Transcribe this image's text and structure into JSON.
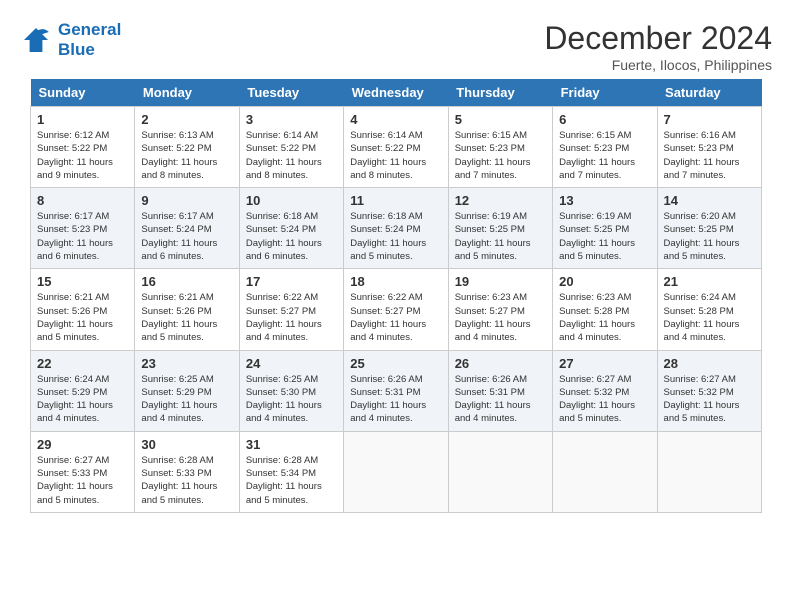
{
  "header": {
    "logo_line1": "General",
    "logo_line2": "Blue",
    "month": "December 2024",
    "location": "Fuerte, Ilocos, Philippines"
  },
  "days_of_week": [
    "Sunday",
    "Monday",
    "Tuesday",
    "Wednesday",
    "Thursday",
    "Friday",
    "Saturday"
  ],
  "weeks": [
    [
      {
        "day": 1,
        "sunrise": "6:12 AM",
        "sunset": "5:22 PM",
        "daylight": "11 hours and 9 minutes."
      },
      {
        "day": 2,
        "sunrise": "6:13 AM",
        "sunset": "5:22 PM",
        "daylight": "11 hours and 8 minutes."
      },
      {
        "day": 3,
        "sunrise": "6:14 AM",
        "sunset": "5:22 PM",
        "daylight": "11 hours and 8 minutes."
      },
      {
        "day": 4,
        "sunrise": "6:14 AM",
        "sunset": "5:22 PM",
        "daylight": "11 hours and 8 minutes."
      },
      {
        "day": 5,
        "sunrise": "6:15 AM",
        "sunset": "5:23 PM",
        "daylight": "11 hours and 7 minutes."
      },
      {
        "day": 6,
        "sunrise": "6:15 AM",
        "sunset": "5:23 PM",
        "daylight": "11 hours and 7 minutes."
      },
      {
        "day": 7,
        "sunrise": "6:16 AM",
        "sunset": "5:23 PM",
        "daylight": "11 hours and 7 minutes."
      }
    ],
    [
      {
        "day": 8,
        "sunrise": "6:17 AM",
        "sunset": "5:23 PM",
        "daylight": "11 hours and 6 minutes."
      },
      {
        "day": 9,
        "sunrise": "6:17 AM",
        "sunset": "5:24 PM",
        "daylight": "11 hours and 6 minutes."
      },
      {
        "day": 10,
        "sunrise": "6:18 AM",
        "sunset": "5:24 PM",
        "daylight": "11 hours and 6 minutes."
      },
      {
        "day": 11,
        "sunrise": "6:18 AM",
        "sunset": "5:24 PM",
        "daylight": "11 hours and 5 minutes."
      },
      {
        "day": 12,
        "sunrise": "6:19 AM",
        "sunset": "5:25 PM",
        "daylight": "11 hours and 5 minutes."
      },
      {
        "day": 13,
        "sunrise": "6:19 AM",
        "sunset": "5:25 PM",
        "daylight": "11 hours and 5 minutes."
      },
      {
        "day": 14,
        "sunrise": "6:20 AM",
        "sunset": "5:25 PM",
        "daylight": "11 hours and 5 minutes."
      }
    ],
    [
      {
        "day": 15,
        "sunrise": "6:21 AM",
        "sunset": "5:26 PM",
        "daylight": "11 hours and 5 minutes."
      },
      {
        "day": 16,
        "sunrise": "6:21 AM",
        "sunset": "5:26 PM",
        "daylight": "11 hours and 5 minutes."
      },
      {
        "day": 17,
        "sunrise": "6:22 AM",
        "sunset": "5:27 PM",
        "daylight": "11 hours and 4 minutes."
      },
      {
        "day": 18,
        "sunrise": "6:22 AM",
        "sunset": "5:27 PM",
        "daylight": "11 hours and 4 minutes."
      },
      {
        "day": 19,
        "sunrise": "6:23 AM",
        "sunset": "5:27 PM",
        "daylight": "11 hours and 4 minutes."
      },
      {
        "day": 20,
        "sunrise": "6:23 AM",
        "sunset": "5:28 PM",
        "daylight": "11 hours and 4 minutes."
      },
      {
        "day": 21,
        "sunrise": "6:24 AM",
        "sunset": "5:28 PM",
        "daylight": "11 hours and 4 minutes."
      }
    ],
    [
      {
        "day": 22,
        "sunrise": "6:24 AM",
        "sunset": "5:29 PM",
        "daylight": "11 hours and 4 minutes."
      },
      {
        "day": 23,
        "sunrise": "6:25 AM",
        "sunset": "5:29 PM",
        "daylight": "11 hours and 4 minutes."
      },
      {
        "day": 24,
        "sunrise": "6:25 AM",
        "sunset": "5:30 PM",
        "daylight": "11 hours and 4 minutes."
      },
      {
        "day": 25,
        "sunrise": "6:26 AM",
        "sunset": "5:31 PM",
        "daylight": "11 hours and 4 minutes."
      },
      {
        "day": 26,
        "sunrise": "6:26 AM",
        "sunset": "5:31 PM",
        "daylight": "11 hours and 4 minutes."
      },
      {
        "day": 27,
        "sunrise": "6:27 AM",
        "sunset": "5:32 PM",
        "daylight": "11 hours and 5 minutes."
      },
      {
        "day": 28,
        "sunrise": "6:27 AM",
        "sunset": "5:32 PM",
        "daylight": "11 hours and 5 minutes."
      }
    ],
    [
      {
        "day": 29,
        "sunrise": "6:27 AM",
        "sunset": "5:33 PM",
        "daylight": "11 hours and 5 minutes."
      },
      {
        "day": 30,
        "sunrise": "6:28 AM",
        "sunset": "5:33 PM",
        "daylight": "11 hours and 5 minutes."
      },
      {
        "day": 31,
        "sunrise": "6:28 AM",
        "sunset": "5:34 PM",
        "daylight": "11 hours and 5 minutes."
      },
      null,
      null,
      null,
      null
    ]
  ],
  "labels": {
    "sunrise": "Sunrise:",
    "sunset": "Sunset:",
    "daylight": "Daylight:"
  }
}
